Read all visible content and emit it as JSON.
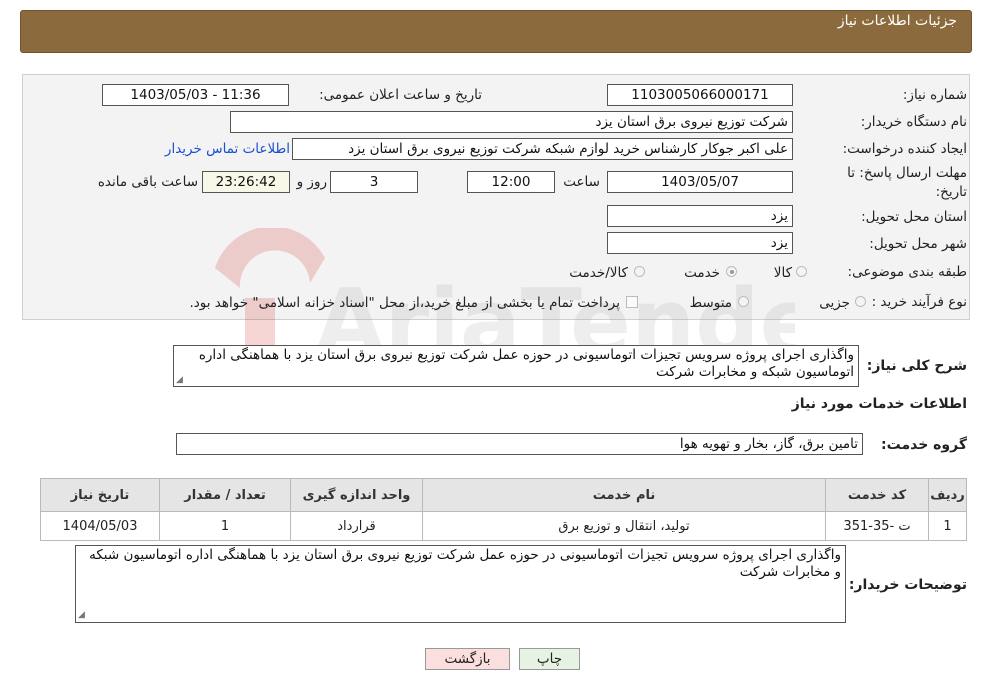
{
  "header": {
    "title": "جزئیات اطلاعات نیاز"
  },
  "form": {
    "need_number": {
      "label": "شماره نیاز:",
      "value": "1103005066000171"
    },
    "announce_datetime": {
      "label": "تاریخ و ساعت اعلان عمومی:",
      "value": "1403/05/03 - 11:36"
    },
    "buyer_org": {
      "label": "نام دستگاه خریدار:",
      "value": "شرکت توزیع نیروی برق استان یزد"
    },
    "requester": {
      "label": "ایجاد کننده درخواست:",
      "value": "علی اکبر  جوکار  کارشناس خرید لوازم شبکه  شرکت توزیع نیروی برق استان یزد",
      "contact_link": "اطلاعات تماس خریدار"
    },
    "deadline": {
      "label_line1": "مهلت ارسال پاسخ: تا",
      "label_line2": "تاریخ:",
      "date": "1403/05/07",
      "time_label": "ساعت",
      "time": "12:00",
      "days": "3",
      "days_label": "روز و",
      "remaining": "23:26:42",
      "remaining_label": "ساعت باقی مانده"
    },
    "province": {
      "label": "استان محل تحویل:",
      "value": "یزد"
    },
    "city": {
      "label": "شهر محل تحویل:",
      "value": "یزد"
    },
    "category": {
      "label": "طبقه بندی موضوعی:",
      "options": [
        "کالا",
        "خدمت",
        "کالا/خدمت"
      ],
      "selected": "خدمت"
    },
    "purchase_type": {
      "label": "نوع فرآیند خرید :",
      "options": [
        "جزیی",
        "متوسط"
      ],
      "note": "پرداخت تمام یا بخشی از مبلغ خرید،از محل \"اسناد خزانه اسلامی\" خواهد بود."
    }
  },
  "summary": {
    "label": "شرح کلی نیاز:",
    "text": "واگذاری اجرای پروژه سرویس تجیزات اتوماسیونی در حوزه عمل شرکت توزیع نیروی برق استان یزد با هماهنگی اداره اتوماسیون شبکه و مخابرات شرکت"
  },
  "services_section": {
    "title": "اطلاعات خدمات مورد نیاز"
  },
  "service_group": {
    "label": "گروه خدمت:",
    "value": "تامین برق، گاز، بخار و تهویه هوا"
  },
  "table": {
    "headers": [
      "ردیف",
      "کد خدمت",
      "نام خدمت",
      "واحد اندازه گیری",
      "تعداد / مقدار",
      "تاریخ نیاز"
    ],
    "rows": [
      [
        "1",
        "ت -35-351",
        "تولید، انتقال و توزیع برق",
        "قرارداد",
        "1",
        "1404/05/03"
      ]
    ]
  },
  "buyer_notes": {
    "label": "توضیحات خریدار:",
    "text": "واگذاری اجرای پروژه سرویس تجیزات اتوماسیونی در حوزه عمل شرکت توزیع نیروی برق استان یزد با هماهنگی   اداره اتوماسیون شبکه و مخابرات شرکت"
  },
  "buttons": {
    "print": "چاپ",
    "back": "بازگشت"
  },
  "watermark": {
    "text": "AriaTender.neT"
  }
}
